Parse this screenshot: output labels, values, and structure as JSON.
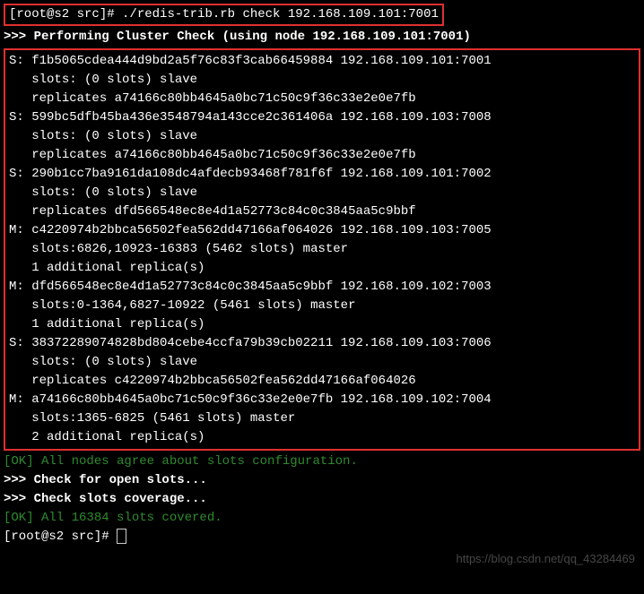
{
  "prompt1": "[root@s2 src]# ",
  "command1": "./redis-trib.rb check 192.168.109.101:7001",
  "header": ">>> Performing Cluster Check (using node 192.168.109.101:7001)",
  "nodes": [
    {
      "line1": "S: f1b5065cdea444d9bd2a5f76c83f3cab66459884 192.168.109.101:7001",
      "line2": "   slots: (0 slots) slave",
      "line3": "   replicates a74166c80bb4645a0bc71c50c9f36c33e2e0e7fb"
    },
    {
      "line1": "S: 599bc5dfb45ba436e3548794a143cce2c361406a 192.168.109.103:7008",
      "line2": "   slots: (0 slots) slave",
      "line3": "   replicates a74166c80bb4645a0bc71c50c9f36c33e2e0e7fb"
    },
    {
      "line1": "S: 290b1cc7ba9161da108dc4afdecb93468f781f6f 192.168.109.101:7002",
      "line2": "   slots: (0 slots) slave",
      "line3": "   replicates dfd566548ec8e4d1a52773c84c0c3845aa5c9bbf"
    },
    {
      "line1": "M: c4220974b2bbca56502fea562dd47166af064026 192.168.109.103:7005",
      "line2": "   slots:6826,10923-16383 (5462 slots) master",
      "line3": "   1 additional replica(s)"
    },
    {
      "line1": "M: dfd566548ec8e4d1a52773c84c0c3845aa5c9bbf 192.168.109.102:7003",
      "line2": "   slots:0-1364,6827-10922 (5461 slots) master",
      "line3": "   1 additional replica(s)"
    },
    {
      "line1": "S: 38372289074828bd804cebe4ccfa79b39cb02211 192.168.109.103:7006",
      "line2": "   slots: (0 slots) slave",
      "line3": "   replicates c4220974b2bbca56502fea562dd47166af064026"
    },
    {
      "line1": "M: a74166c80bb4645a0bc71c50c9f36c33e2e0e7fb 192.168.109.102:7004",
      "line2": "   slots:1365-6825 (5461 slots) master",
      "line3": "   2 additional replica(s)"
    }
  ],
  "ok_slots": "[OK] All nodes agree about slots configuration.",
  "check_open": ">>> Check for open slots...",
  "check_coverage": ">>> Check slots coverage...",
  "ok_covered": "[OK] All 16384 slots covered.",
  "prompt2": "[root@s2 src]# ",
  "watermark": "https://blog.csdn.net/qq_43284469"
}
